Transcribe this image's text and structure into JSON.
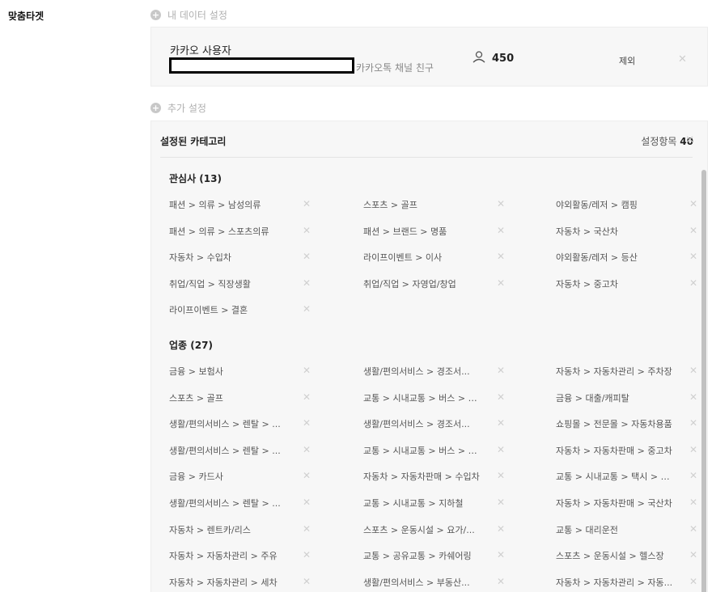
{
  "left_label": "맞춤타겟",
  "my_data": {
    "section_label": "내 데이터 설정",
    "name": "카카오 사용자",
    "subtitle": "카카오톡 채널 친구",
    "count": "450",
    "exclude_label": "제외"
  },
  "extra": {
    "section_label": "추가 설정",
    "title": "설정된 카테고리",
    "count_label": "설정항목",
    "count_value": "40"
  },
  "groups": [
    {
      "title": "관심사 (13)",
      "rows": [
        [
          "패션 > 의류 > 남성의류",
          "스포츠 > 골프",
          "야외활동/레저 > 캠핑"
        ],
        [
          "패션 > 의류 > 스포츠의류",
          "패션 > 브랜드 > 명품",
          "자동차 > 국산차"
        ],
        [
          "자동차 > 수입차",
          "라이프이벤트 > 이사",
          "야외활동/레저 > 등산"
        ],
        [
          "취업/직업 > 직장생활",
          "취업/직업 > 자영업/창업",
          "자동차 > 중고차"
        ],
        [
          "라이프이벤트 > 결혼"
        ]
      ]
    },
    {
      "title": "업종 (27)",
      "rows": [
        [
          "금융 > 보험사",
          "생활/편의서비스 > 경조서...",
          "자동차 > 자동차관리 > 주차장"
        ],
        [
          "스포츠 > 골프",
          "교통 > 시내교통 > 버스 > 시...",
          "금융 > 대출/캐피탈"
        ],
        [
          "생활/편의서비스 > 렌탈 > ...",
          "생활/편의서비스 > 경조서...",
          "쇼핑몰 > 전문몰 > 자동차용품"
        ],
        [
          "생활/편의서비스 > 렌탈 > ...",
          "교통 > 시내교통 > 버스 > 시...",
          "자동차 > 자동차판매 > 중고차"
        ],
        [
          "금융 > 카드사",
          "자동차 > 자동차판매 > 수입차",
          "교통 > 시내교통 > 택시 > 콜..."
        ],
        [
          "생활/편의서비스 > 렌탈 > ...",
          "교통 > 시내교통 > 지하철",
          "자동차 > 자동차판매 > 국산차"
        ],
        [
          "자동차 > 렌트카/리스",
          "스포츠 > 운동시설 > 요가/...",
          "교통 > 대리운전"
        ],
        [
          "자동차 > 자동차관리 > 주유",
          "교통 > 공유교통 > 카쉐어링",
          "스포츠 > 운동시설 > 헬스장"
        ],
        [
          "자동차 > 자동차관리 > 세차",
          "생활/편의서비스 > 부동산...",
          "자동차 > 자동차관리 > 자동..."
        ]
      ]
    }
  ]
}
